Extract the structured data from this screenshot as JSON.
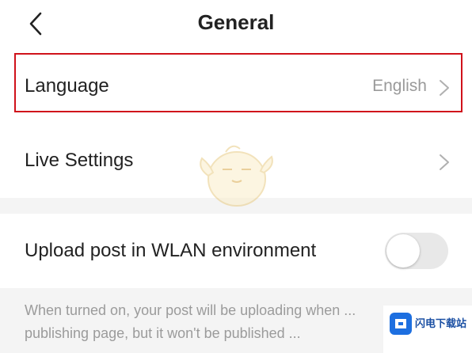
{
  "header": {
    "back_icon": "chevron-left-icon",
    "title": "General"
  },
  "settings": {
    "language": {
      "label": "Language",
      "value": "English",
      "icon": "chevron-right-icon",
      "highlighted": true,
      "highlight_color": "#d0121b"
    },
    "live": {
      "label": "Live Settings",
      "icon": "chevron-right-icon"
    },
    "upload": {
      "label": "Upload post in WLAN environment",
      "toggle_on": false
    }
  },
  "hint": {
    "text": "When turned on, your post will be uploading when ... publishing page, but it won't be published ..."
  },
  "watermark": {
    "logo_icon": "download-site-logo",
    "text": "闪电下载站"
  },
  "colors": {
    "background": "#f4f4f4",
    "row_background": "#ffffff",
    "secondary_text": "#9a9a9a",
    "toggle_off": "#e8e8e8"
  }
}
